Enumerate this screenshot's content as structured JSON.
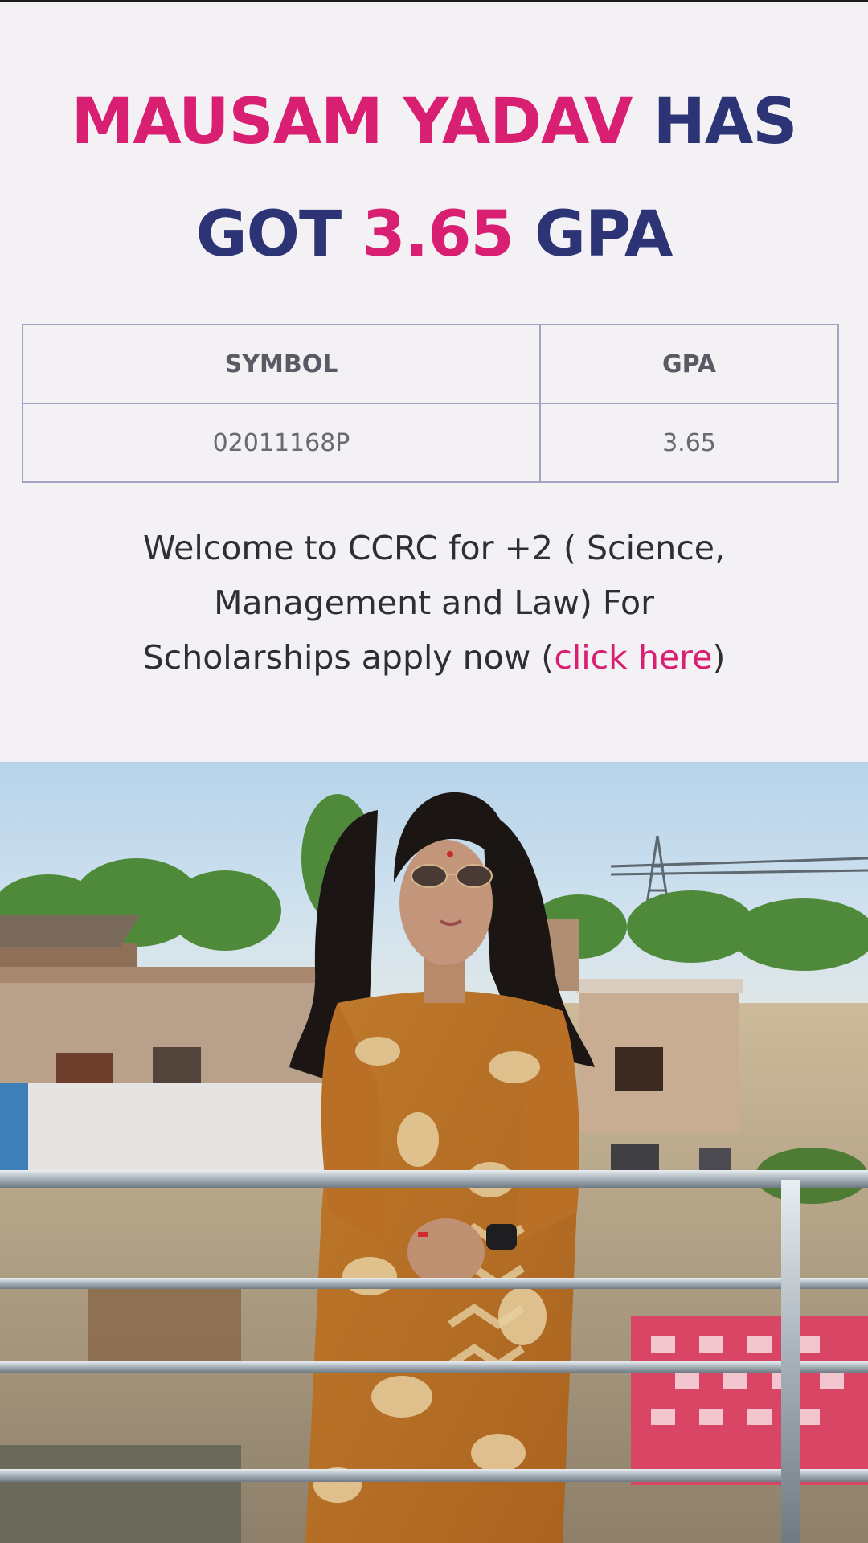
{
  "headline": {
    "name": "MAUSAM YADAV",
    "has": "HAS",
    "got": "GOT",
    "gpa_value": "3.65",
    "gpa_word": "GPA"
  },
  "table": {
    "headers": [
      "SYMBOL",
      "GPA"
    ],
    "rows": [
      [
        "02011168P",
        "3.65"
      ]
    ]
  },
  "welcome": {
    "line1": "Welcome to CCRC for +2 ( Science,",
    "line2": "Management and Law) For",
    "line3_prefix": "Scholarships apply now (",
    "link_text": "click here",
    "line3_suffix": ")"
  },
  "colors": {
    "accent_pink": "#d91f72",
    "navy": "#2c3476",
    "table_border": "#a6a2c4",
    "background": "#f4f1f5"
  }
}
